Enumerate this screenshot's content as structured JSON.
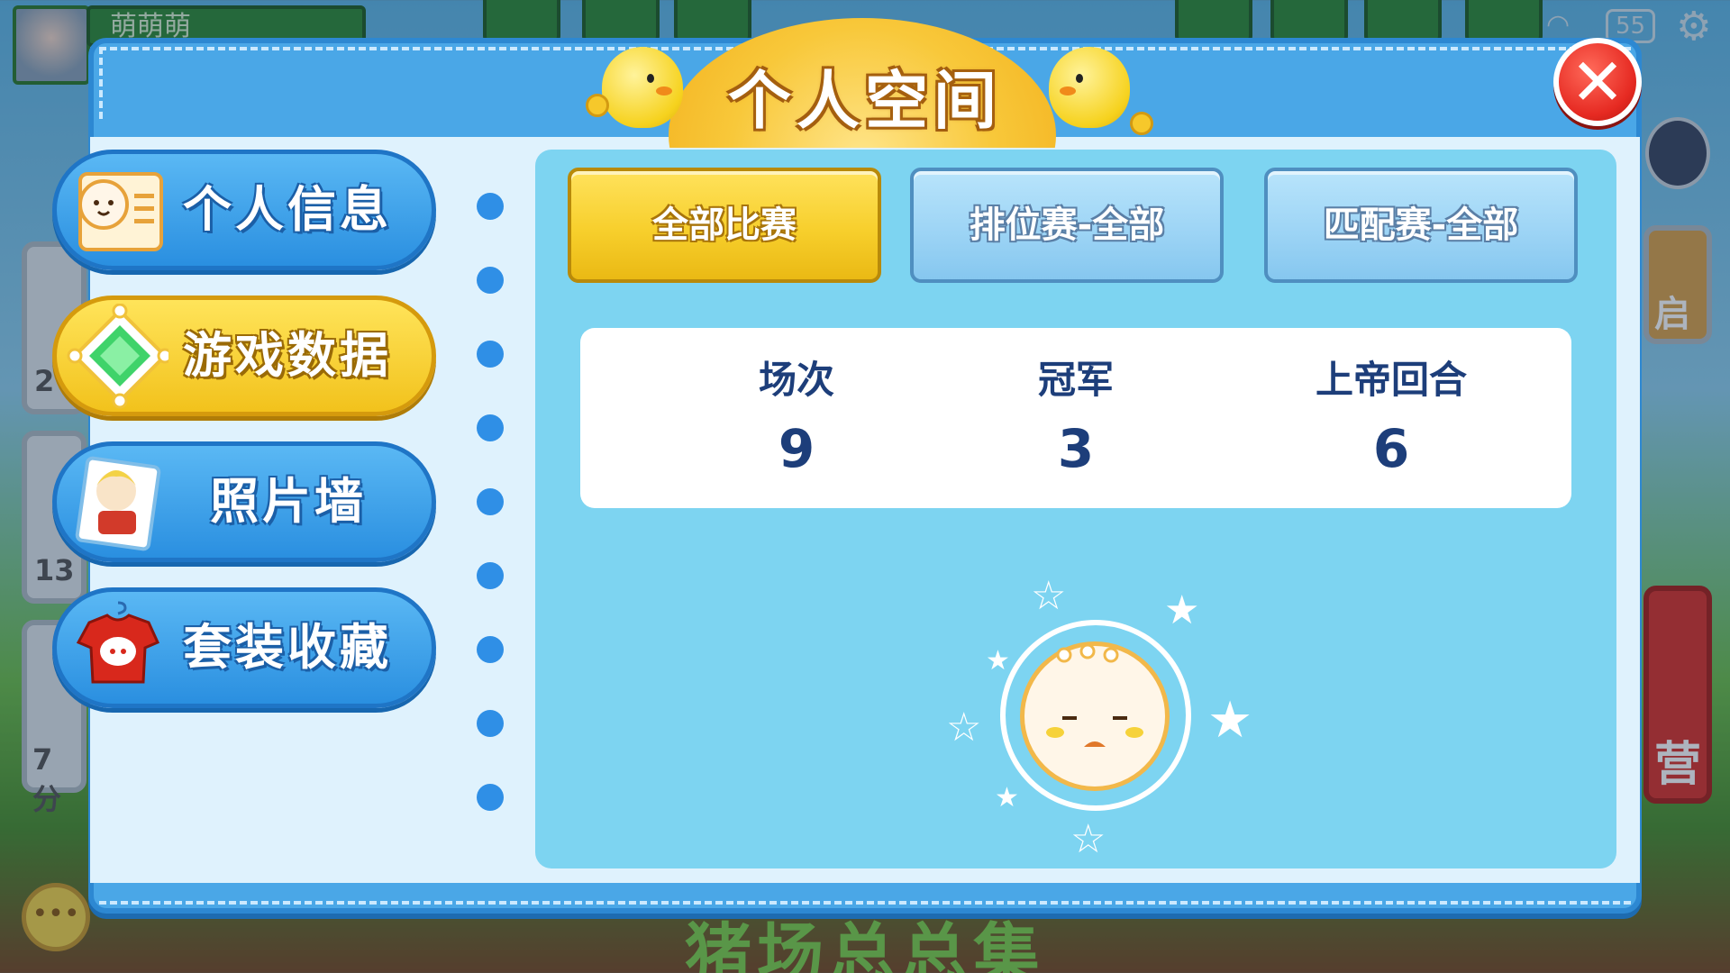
{
  "player": {
    "name": "萌萌萌"
  },
  "status": {
    "battery": "55"
  },
  "panel": {
    "title": "个人空间",
    "close_label": "✕"
  },
  "menu": {
    "items": [
      {
        "label": "个人信息",
        "icon": "profile-card-icon",
        "active": false
      },
      {
        "label": "游戏数据",
        "icon": "diamond-icon",
        "active": true
      },
      {
        "label": "照片墙",
        "icon": "photo-icon",
        "active": false
      },
      {
        "label": "套装收藏",
        "icon": "outfit-icon",
        "active": false
      }
    ]
  },
  "tabs": [
    {
      "label": "全部比赛",
      "active": true
    },
    {
      "label": "排位赛-全部",
      "active": false
    },
    {
      "label": "匹配赛-全部",
      "active": false
    }
  ],
  "stats": [
    {
      "label": "场次",
      "value": "9"
    },
    {
      "label": "冠军",
      "value": "3"
    },
    {
      "label": "上帝回合",
      "value": "6"
    }
  ],
  "background": {
    "banner_text": "猪场总总集",
    "card_texts": [
      "2",
      "13",
      "7分",
      "启",
      "营"
    ]
  },
  "colors": {
    "panel_blue": "#4aa7e7",
    "content_blue": "#7dd4f1",
    "active_yellow": "#f7cf2c",
    "close_red": "#e62a22",
    "stat_text": "#1d3e7a"
  }
}
